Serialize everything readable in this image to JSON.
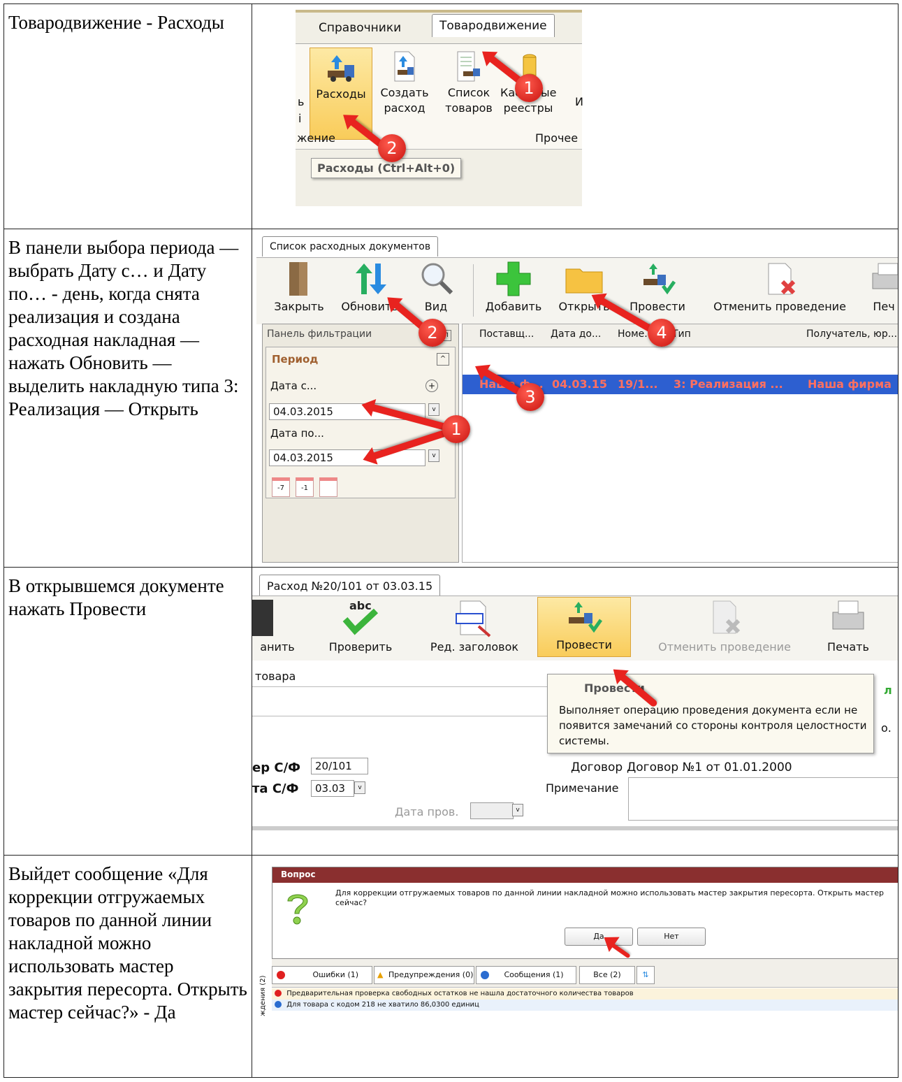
{
  "rows": [
    {
      "text": "Товародвижение - Расходы",
      "shot": {
        "tab_reference": "Справочники",
        "tab_movement": "Товародвижение",
        "btn_expenses_label": "Расходы",
        "btn_create_expense_label": "Создать расход",
        "btn_goods_list_label": "Список товаров",
        "btn_cash_registries_label": "Кассовые реестры",
        "group_left_label": "жение",
        "group_right_label": "Прочее",
        "tooltip": "Расходы (Ctrl+Alt+0)",
        "partial_left_chars": "ь",
        "partial_left_chars2": "і",
        "badges": [
          "1",
          "2"
        ]
      }
    },
    {
      "text": "В панели выбора периода — выбрать Дату с… и Дату по… - день, когда снята реализация и создана расходная накладная — нажать Обновить — выделить накладную типа 3: Реализация — Открыть",
      "shot": {
        "tab_title": "Список расходных документов",
        "toolbar": [
          "Закрыть",
          "Обновить",
          "Вид",
          "Добавить",
          "Открыть",
          "Провести",
          "Отменить проведение",
          "Печ"
        ],
        "filter_panel_title": "Панель фильтрации",
        "period_label": "Период",
        "date_from_label": "Дата с...",
        "date_from_value": "04.03.2015",
        "date_to_label": "Дата по...",
        "date_to_value": "04.03.2015",
        "calendar_buttons": [
          "-7",
          "-1",
          ""
        ],
        "columns": [
          "Поставщ...",
          "Дата до...",
          "Номе...",
          "Тип",
          "Получатель, юр..."
        ],
        "row": [
          "Наша ф...",
          "04.03.15",
          "19/1...",
          "3: Реализация ...",
          "Наша фирма"
        ],
        "badges": [
          "2",
          "4",
          "3",
          "1"
        ]
      }
    },
    {
      "text": "В открывшемся документе нажать Провести",
      "shot": {
        "tab_title": "Расход №20/101 от 03.03.15",
        "toolbar": [
          "анить",
          "Проверить",
          "Ред. заголовок",
          "Провести",
          "Отменить проведение",
          "Печать"
        ],
        "label_goods": "товара",
        "tooltip_title": "Провести",
        "tooltip_text": "Выполняет операцию проведения документа если не появится замечаний со стороны контроля целостности системы.",
        "invoice_number_label": "ер С/Ф",
        "invoice_number_value": "20/101",
        "invoice_date_label": "та С/Ф",
        "invoice_date_value": "03.03",
        "contract_label": "Договор",
        "contract_value": "Договор №1 от 01.01.2000",
        "note_label": "Примечание",
        "posting_date_label": "Дата пров.",
        "right_edge_letters": [
          "л",
          "о."
        ]
      }
    },
    {
      "text": "Выйдет сообщение «Для коррекции отгружаемых товаров по данной линии накладной можно использовать мастер закрытия пересорта. Открыть мастер сейчас?» - Да",
      "shot": {
        "dialog_title": "Вопрос",
        "dialog_text": "Для коррекции отгружаемых товаров по данной линии накладной можно использовать мастер закрытия пересорта. Открыть мастер сейчас?",
        "btn_yes": "Да",
        "btn_no": "Нет",
        "tabs": [
          "Ошибки (1)",
          "Предупреждения (0)",
          "Сообщения (1)",
          "Все (2)"
        ],
        "side_label": "ждения (2)",
        "messages": [
          "Предварительная проверка свободных остатков не нашла достаточного количества товаров",
          "Для товара с кодом 218 не хватило 86,0300 единиц"
        ]
      }
    }
  ],
  "colors": {
    "accent_red": "#e8231f",
    "selection_blue": "#3366cc",
    "selection_text": "#ff6b5b",
    "ribbon_bg": "#f1efe6",
    "highlight": "#fbd66b"
  }
}
